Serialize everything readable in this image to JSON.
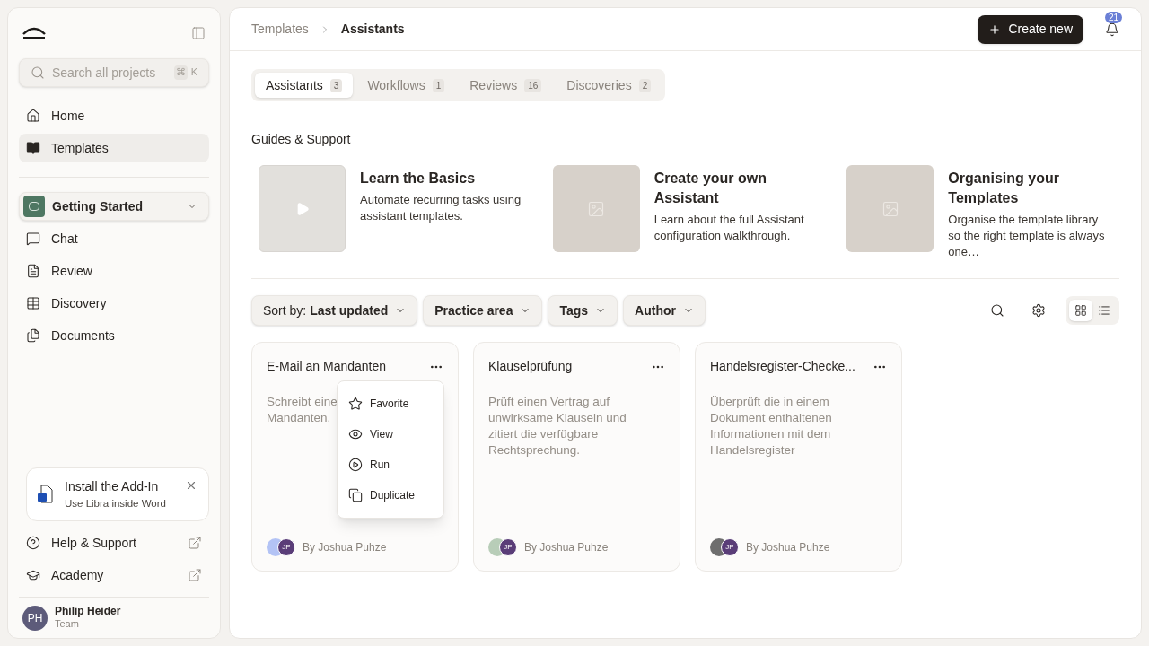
{
  "sidebar": {
    "search": {
      "placeholder": "Search all projects",
      "shortcut_symbol": "⌘",
      "shortcut_key": "K"
    },
    "nav": [
      {
        "label": "Home",
        "selected": false
      },
      {
        "label": "Templates",
        "selected": true
      }
    ],
    "project": {
      "name": "Getting Started"
    },
    "project_nav": [
      "Chat",
      "Review",
      "Discovery",
      "Documents"
    ],
    "addin": {
      "title": "Install the Add-In",
      "subtitle": "Use Libra inside Word"
    },
    "links": [
      "Help & Support",
      "Academy"
    ],
    "user": {
      "initials": "PH",
      "name": "Philip Heider",
      "team": "Team"
    }
  },
  "breadcrumb": [
    "Templates",
    "Assistants"
  ],
  "create_button": "Create new",
  "notifications": "21",
  "tabs": [
    {
      "label": "Assistants",
      "count": "3",
      "selected": true
    },
    {
      "label": "Workflows",
      "count": "1",
      "selected": false
    },
    {
      "label": "Reviews",
      "count": "16",
      "selected": false
    },
    {
      "label": "Discoveries",
      "count": "2",
      "selected": false
    }
  ],
  "guides_title": "Guides & Support",
  "guides": [
    {
      "title": "Learn the Basics",
      "text": "Automate recurring tasks using assistant templates.",
      "kind": "video"
    },
    {
      "title": "Create your own Assistant",
      "text": "Learn about the full Assistant configuration walkthrough.",
      "kind": "image"
    },
    {
      "title": "Organising your Templates",
      "text": "Organise the template library so the right template is always one…",
      "kind": "image"
    }
  ],
  "filters": [
    {
      "prefix": "Sort by:",
      "label": "Last updated"
    },
    {
      "label": "Practice area"
    },
    {
      "label": "Tags"
    },
    {
      "label": "Author"
    }
  ],
  "view_toggle": [
    {
      "kind": "grid",
      "selected": true
    },
    {
      "kind": "list",
      "selected": false
    }
  ],
  "cards": [
    {
      "title": "E-Mail an Mandanten",
      "description_lines": [
        "Schreibt eine",
        "Mandanten."
      ],
      "author": "By Joshua Puhze",
      "initials": "JP",
      "color": "#b3c3f5",
      "menu": [
        "Favorite",
        "View",
        "Run",
        "Duplicate"
      ]
    },
    {
      "title": "Klauselprüfung",
      "description_lines": [
        "Prüft einen Vertrag auf",
        "unwirksame Klauseln und",
        "zitiert die verfügbare",
        "Rechtsprechung."
      ],
      "author": "By Joshua Puhze",
      "initials": "JP",
      "color": "#b8cdb8"
    },
    {
      "title": "Handelsregister-Checke...",
      "description_lines": [
        "Überprüft die in einem",
        "Dokument enthaltenen",
        "Informationen mit dem",
        "Handelsregister"
      ],
      "author": "By Joshua Puhze",
      "initials": "JP",
      "color": "#6e6e6e"
    }
  ]
}
